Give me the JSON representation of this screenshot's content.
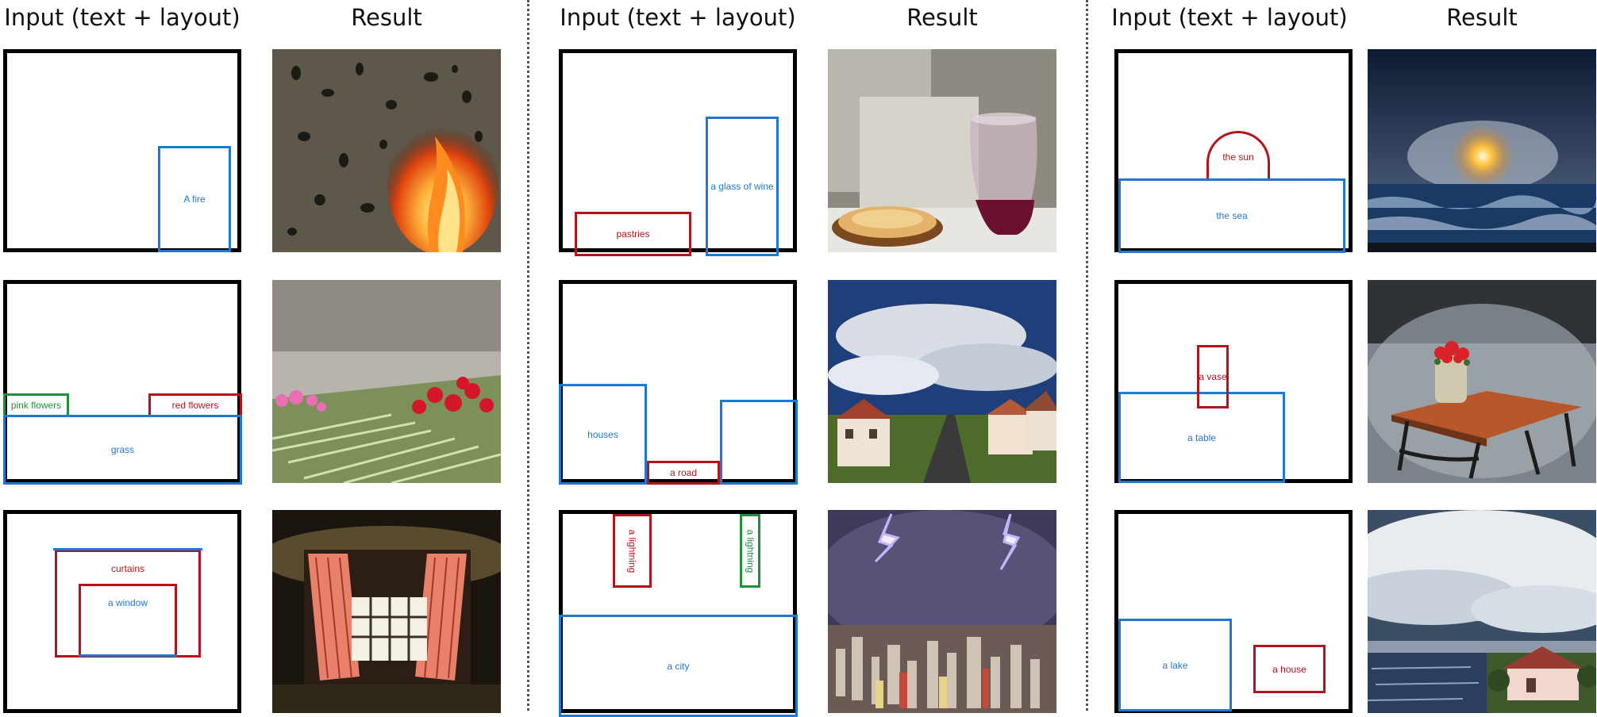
{
  "headers": {
    "input": "Input (text + layout)",
    "result": "Result"
  },
  "labels": {
    "fire": "A fire",
    "pastries": "pastries",
    "wine": "a glass of wine",
    "sun": "the sun",
    "sea": "the sea",
    "pink_flowers": "pink flowers",
    "red_flowers": "red flowers",
    "grass": "grass",
    "houses": "houses",
    "road": "a road",
    "vase": "a vase",
    "table": "a table",
    "curtains": "curtains",
    "window": "a window",
    "lightning_1": "a lightning",
    "lightning_2": "a lightning",
    "city": "a city",
    "lake": "a lake",
    "house": "a house"
  },
  "colors": {
    "blue_box": "#1f78d1",
    "red_box": "#b3141c",
    "green_box": "#1f8f3a"
  }
}
